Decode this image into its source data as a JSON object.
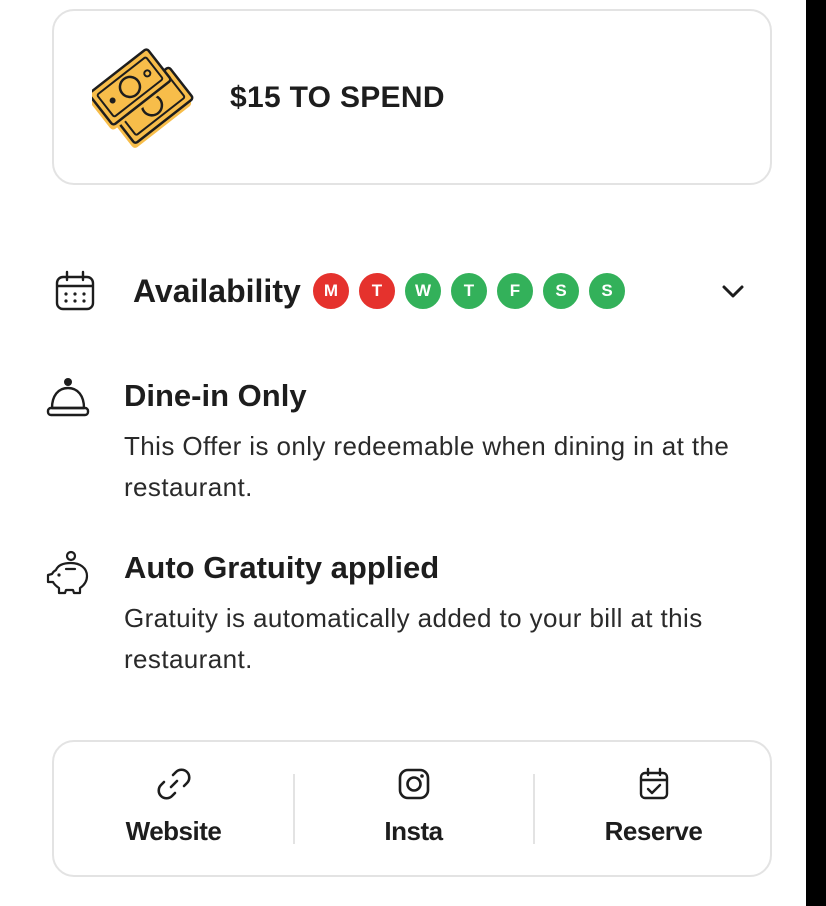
{
  "offer": {
    "title": "$15 TO SPEND",
    "icon": "money-bills-icon"
  },
  "availability": {
    "label": "Availability",
    "days": [
      {
        "letter": "M",
        "available": false,
        "color": "#e5322d"
      },
      {
        "letter": "T",
        "available": false,
        "color": "#e5322d"
      },
      {
        "letter": "W",
        "available": true,
        "color": "#33b15a"
      },
      {
        "letter": "T",
        "available": true,
        "color": "#33b15a"
      },
      {
        "letter": "F",
        "available": true,
        "color": "#33b15a"
      },
      {
        "letter": "S",
        "available": true,
        "color": "#33b15a"
      },
      {
        "letter": "S",
        "available": true,
        "color": "#33b15a"
      }
    ]
  },
  "dine_in": {
    "title": "Dine-in Only",
    "description": "This Offer is only redeemable when dining in at the restaurant."
  },
  "gratuity": {
    "title": "Auto Gratuity applied",
    "description": "Gratuity is automatically added to your bill at this restaurant."
  },
  "links": [
    {
      "label": "Website",
      "icon": "link-icon"
    },
    {
      "label": "Insta",
      "icon": "instagram-icon"
    },
    {
      "label": "Reserve",
      "icon": "calendar-check-icon"
    }
  ],
  "colors": {
    "unavailable": "#e5322d",
    "available": "#33b15a",
    "money_accent": "#f7bd4a"
  }
}
